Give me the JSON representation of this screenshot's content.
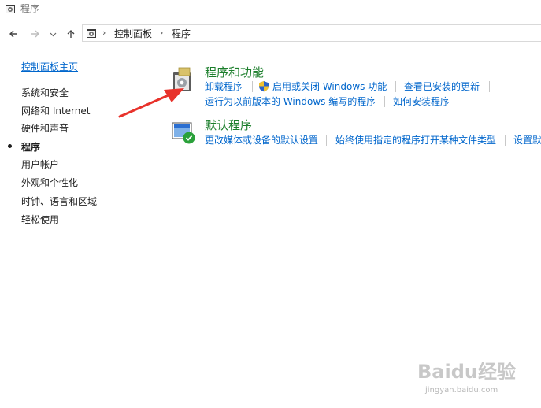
{
  "window": {
    "title": "程序"
  },
  "navigation": {
    "back_icon": "arrow-left-icon",
    "forward_icon": "arrow-right-icon",
    "recent_icon": "chevron-down-icon",
    "up_icon": "arrow-up-icon",
    "breadcrumb": [
      "控制面板",
      "程序"
    ]
  },
  "sidebar": {
    "home_label": "控制面板主页",
    "items": [
      "系统和安全",
      "网络和 Internet",
      "硬件和声音",
      "程序",
      "用户帐户",
      "外观和个性化",
      "时钟、语言和区域",
      "轻松使用"
    ],
    "current": "程序"
  },
  "sections": [
    {
      "title": "程序和功能",
      "icon": "programs-and-features-icon",
      "tasks_row1": [
        "卸载程序",
        "启用或关闭 Windows 功能",
        "查看已安装的更新"
      ],
      "tasks_row2": [
        "运行为以前版本的 Windows 编写的程序",
        "如何安装程序"
      ]
    },
    {
      "title": "默认程序",
      "icon": "default-programs-icon",
      "tasks_row1": [
        "更改媒体或设备的默认设置",
        "始终使用指定的程序打开某种文件类型",
        "设置默"
      ]
    }
  ],
  "watermark": {
    "main": "Baidu经验",
    "sub": "jingyan.baidu.com"
  },
  "colors": {
    "link": "#0066cc",
    "section_title": "#1b7e2b",
    "annotation_arrow": "#e8322b"
  }
}
